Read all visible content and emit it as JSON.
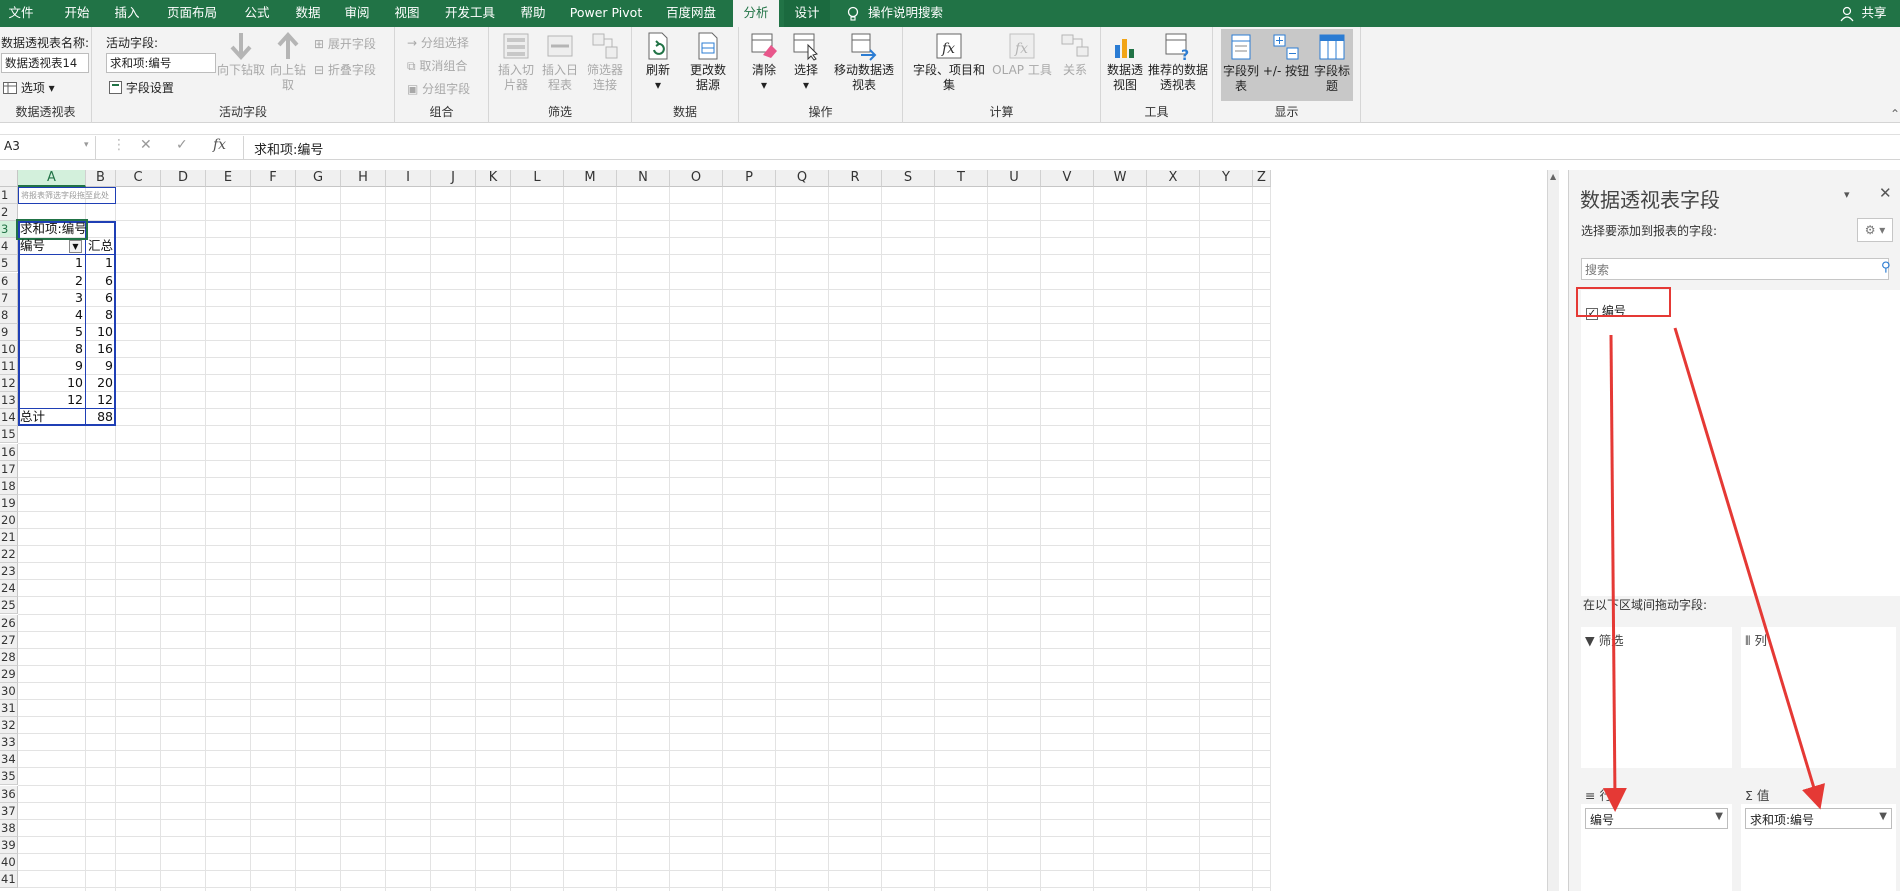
{
  "tabs": [
    "文件",
    "开始",
    "插入",
    "页面布局",
    "公式",
    "数据",
    "审阅",
    "视图",
    "开发工具",
    "帮助",
    "Power Pivot",
    "百度网盘",
    "分析",
    "设计"
  ],
  "tell_me": "操作说明搜索",
  "share": "共享",
  "ribbon": {
    "pivot_name_label": "数据透视表名称:",
    "pivot_name_value": "数据透视表14",
    "options": "选项",
    "group_pivot": "数据透视表",
    "active_field_label": "活动字段:",
    "active_field_value": "求和项:编号",
    "field_settings": "字段设置",
    "drill_down": "向下钻取",
    "drill_up": "向上钻取",
    "expand_field": "展开字段",
    "collapse_field": "折叠字段",
    "group_active_field": "活动字段",
    "group_selection": "分组选择",
    "ungroup": "取消组合",
    "group_field": "分组字段",
    "group_group": "组合",
    "insert_slicer": "插入切片器",
    "insert_timeline": "插入日程表",
    "filter_connections": "筛选器连接",
    "group_filter": "筛选",
    "refresh": "刷新",
    "change_source": "更改数据源",
    "group_data": "数据",
    "clear": "清除",
    "select": "选择",
    "move_pivot": "移动数据透视表",
    "group_actions": "操作",
    "fields_items_sets": "字段、项目和集",
    "olap_tools": "OLAP 工具",
    "relationships": "关系",
    "group_calc": "计算",
    "pivot_chart": "数据透视图",
    "recommended_pivot": "推荐的数据透视表",
    "group_tools": "工具",
    "field_list": "字段列表",
    "plus_minus_buttons": "+/- 按钮",
    "field_headers": "字段标题",
    "group_show": "显示"
  },
  "formula_bar": {
    "name_box": "A3",
    "content": "求和项:编号"
  },
  "columns": [
    "A",
    "B",
    "C",
    "D",
    "E",
    "F",
    "G",
    "H",
    "I",
    "J",
    "K",
    "L",
    "M",
    "N",
    "O",
    "P",
    "Q",
    "R",
    "S",
    "T",
    "U",
    "V",
    "W",
    "X",
    "Y",
    "Z"
  ],
  "rows": [
    "1",
    "2",
    "3",
    "4",
    "5",
    "6",
    "7",
    "8",
    "9",
    "10",
    "11",
    "12",
    "13",
    "14",
    "15",
    "16",
    "17",
    "18",
    "19",
    "20",
    "21",
    "22",
    "23",
    "24",
    "25",
    "26",
    "27",
    "28",
    "29",
    "30",
    "31",
    "32",
    "33",
    "34",
    "35",
    "36",
    "37",
    "38",
    "39",
    "40",
    "41"
  ],
  "pivot": {
    "filter_hint": "将报表筛选字段拖至此处",
    "value_header": "求和项:编号",
    "row_header": "编号",
    "total_header": "汇总",
    "rows": [
      {
        "key": "1",
        "value": "1"
      },
      {
        "key": "2",
        "value": "6"
      },
      {
        "key": "3",
        "value": "6"
      },
      {
        "key": "4",
        "value": "8"
      },
      {
        "key": "5",
        "value": "10"
      },
      {
        "key": "8",
        "value": "16"
      },
      {
        "key": "9",
        "value": "9"
      },
      {
        "key": "10",
        "value": "20"
      },
      {
        "key": "12",
        "value": "12"
      }
    ],
    "grand_total_label": "总计",
    "grand_total_value": "88"
  },
  "pane": {
    "title": "数据透视表字段",
    "subtitle": "选择要添加到报表的字段:",
    "search_placeholder": "搜索",
    "field": "编号",
    "areas_label": "在以下区域间拖动字段:",
    "filters": "筛选",
    "columns": "列",
    "rows": "行",
    "values": "值",
    "row_item": "编号",
    "value_item": "求和项:编号"
  },
  "colors": {
    "excel_green": "#217346",
    "annotation_red": "#e53935",
    "pivot_blue": "#1f3fb5"
  }
}
